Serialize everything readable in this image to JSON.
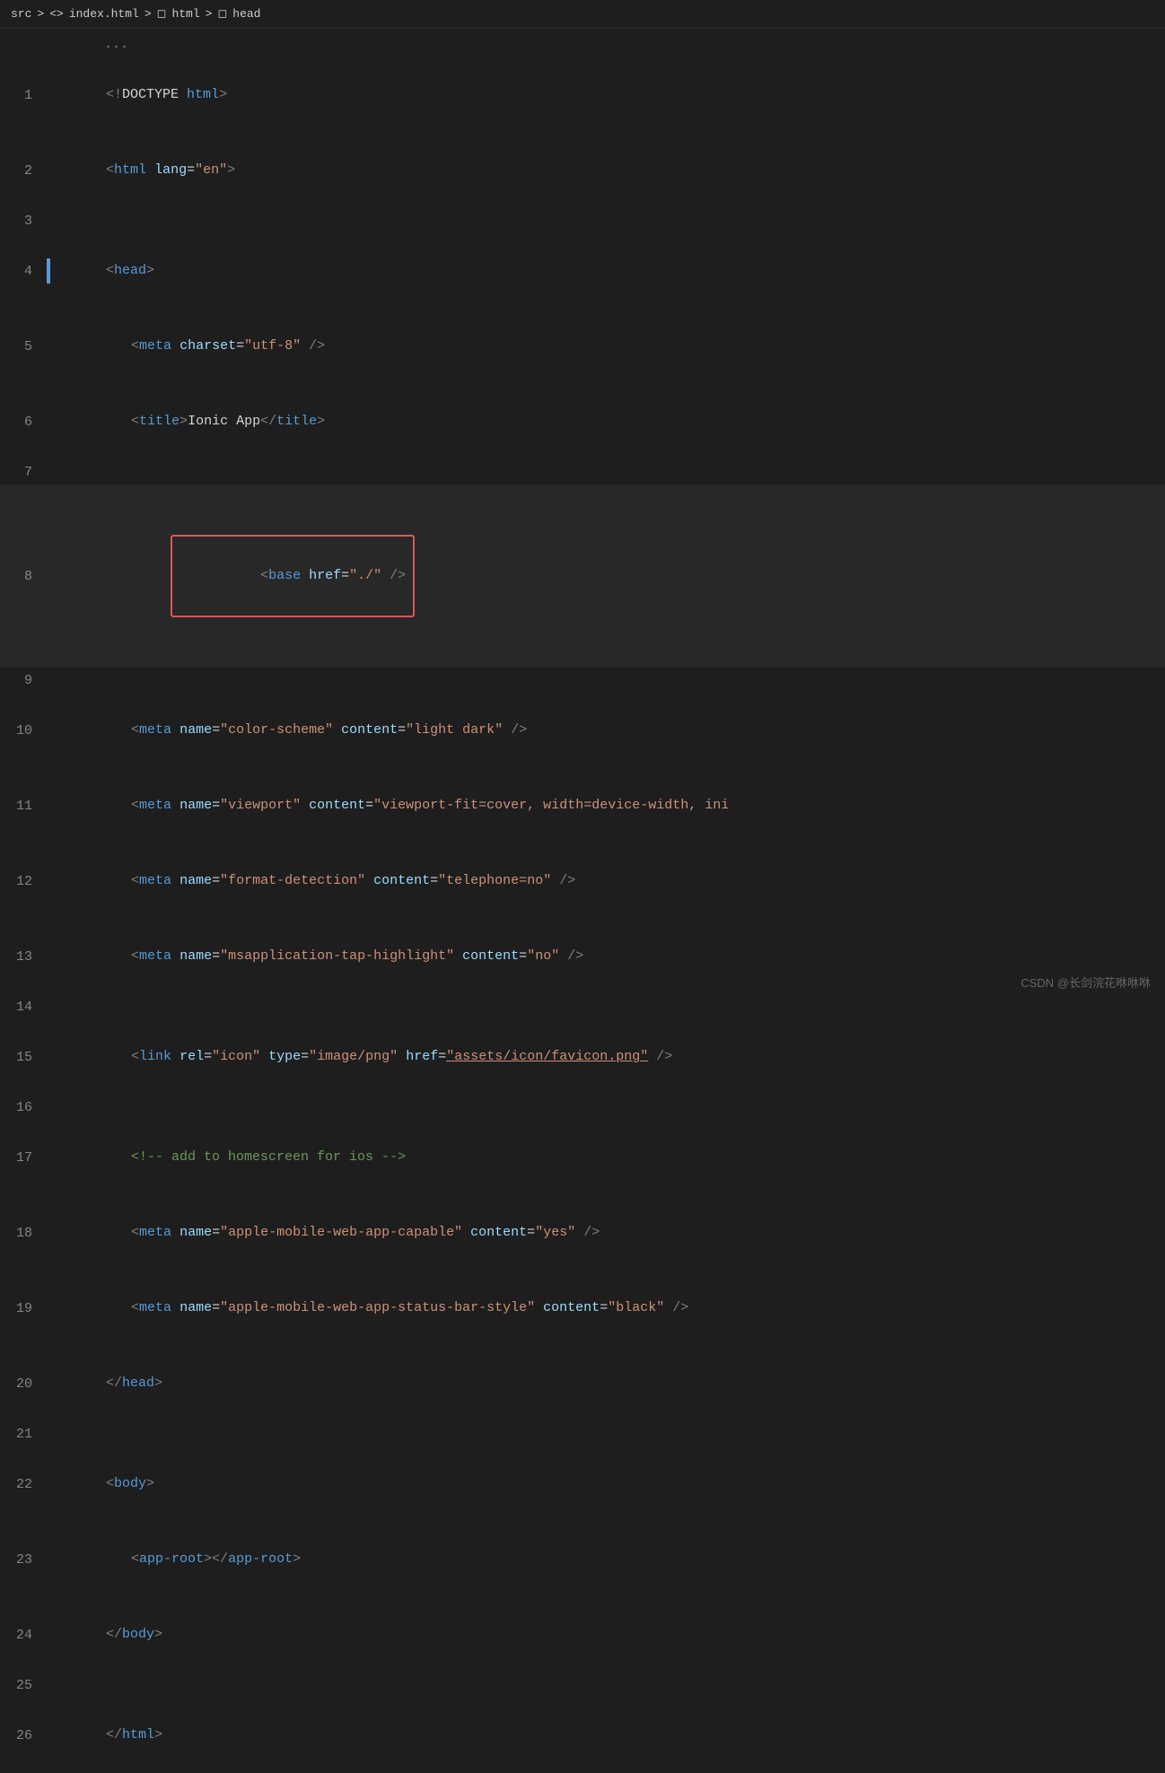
{
  "breadcrumb": {
    "parts": [
      "src",
      ">",
      "index.html",
      ">",
      "html",
      ">",
      "head"
    ]
  },
  "watermark": "CSDN @长剑浣花咻咻咻",
  "lines": [
    {
      "num": "",
      "content": "ellipsis"
    },
    {
      "num": "1",
      "type": "doctype"
    },
    {
      "num": "2",
      "type": "html-open"
    },
    {
      "num": "3",
      "type": "empty"
    },
    {
      "num": "4",
      "type": "head-open",
      "active": true
    },
    {
      "num": "5",
      "type": "meta-charset"
    },
    {
      "num": "6",
      "type": "title"
    },
    {
      "num": "7",
      "type": "empty"
    },
    {
      "num": "8",
      "type": "base",
      "highlight": true
    },
    {
      "num": "9",
      "type": "empty"
    },
    {
      "num": "10",
      "type": "meta-color-scheme"
    },
    {
      "num": "11",
      "type": "meta-viewport"
    },
    {
      "num": "12",
      "type": "meta-format-detection"
    },
    {
      "num": "13",
      "type": "meta-msapplication"
    },
    {
      "num": "14",
      "type": "empty"
    },
    {
      "num": "15",
      "type": "link-icon"
    },
    {
      "num": "16",
      "type": "empty"
    },
    {
      "num": "17",
      "type": "comment-ios"
    },
    {
      "num": "18",
      "type": "meta-apple-capable"
    },
    {
      "num": "19",
      "type": "meta-apple-status"
    },
    {
      "num": "20",
      "type": "head-close"
    },
    {
      "num": "21",
      "type": "empty"
    },
    {
      "num": "22",
      "type": "body-open"
    },
    {
      "num": "23",
      "type": "app-root"
    },
    {
      "num": "24",
      "type": "body-close"
    },
    {
      "num": "25",
      "type": "empty"
    },
    {
      "num": "26",
      "type": "html-close"
    }
  ]
}
